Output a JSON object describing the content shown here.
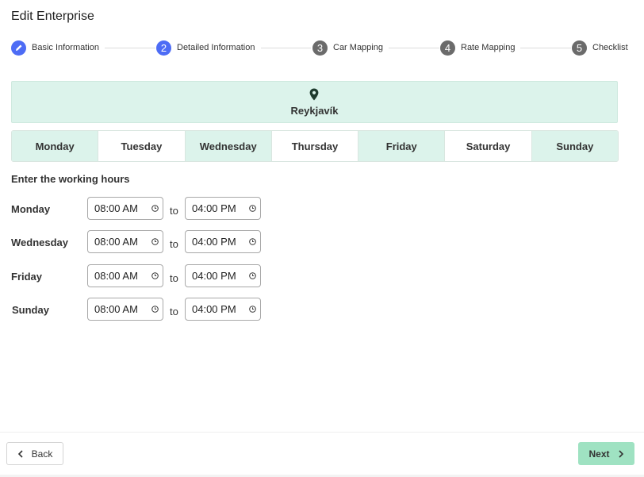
{
  "page": {
    "title": "Edit Enterprise"
  },
  "stepper": {
    "steps": [
      {
        "num": "",
        "label": "Basic Information",
        "state": "done"
      },
      {
        "num": "2",
        "label": "Detailed Information",
        "state": "active"
      },
      {
        "num": "3",
        "label": "Car Mapping",
        "state": "todo"
      },
      {
        "num": "4",
        "label": "Rate Mapping",
        "state": "todo"
      },
      {
        "num": "5",
        "label": "Checklist",
        "state": "todo"
      }
    ]
  },
  "location": {
    "city": "Reykjavík",
    "icon": "location-pin-icon"
  },
  "days": [
    {
      "label": "Monday",
      "selected": true
    },
    {
      "label": "Tuesday",
      "selected": false
    },
    {
      "label": "Wednesday",
      "selected": true
    },
    {
      "label": "Thursday",
      "selected": false
    },
    {
      "label": "Friday",
      "selected": true
    },
    {
      "label": "Saturday",
      "selected": false
    },
    {
      "label": "Sunday",
      "selected": true
    }
  ],
  "hours": {
    "label": "Enter the working hours",
    "to_label": "to",
    "rows": [
      {
        "day": "Monday",
        "from": "08:00 AM",
        "to": "04:00 PM"
      },
      {
        "day": "Wednesday",
        "from": "08:00 AM",
        "to": "04:00 PM"
      },
      {
        "day": "Friday",
        "from": "08:00 AM",
        "to": "04:00 PM"
      },
      {
        "day": "Sunday",
        "from": "08:00 AM",
        "to": "04:00 PM"
      }
    ]
  },
  "footer": {
    "back_label": "Back",
    "next_label": "Next"
  },
  "colors": {
    "accent": "#4d6cf5",
    "mint": "#dcf3eb",
    "next_button": "#9fe2c2",
    "step_todo": "#6b6b6b"
  }
}
